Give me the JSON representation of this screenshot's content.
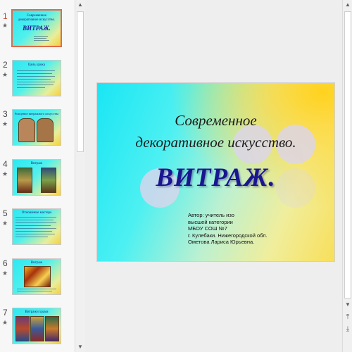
{
  "thumbnails": [
    {
      "number": "1",
      "title_lines": [
        "Современное",
        "декоративное искусство.",
        "ВИТРАЖ."
      ]
    },
    {
      "number": "2",
      "title_lines": [
        "Цель урока"
      ]
    },
    {
      "number": "3",
      "title_lines": [
        "Рождение витражного искусства"
      ]
    },
    {
      "number": "4",
      "title_lines": [
        "Витраж"
      ]
    },
    {
      "number": "5",
      "title_lines": [
        "Отношение мастера"
      ]
    },
    {
      "number": "6",
      "title_lines": [
        "Витраж"
      ]
    },
    {
      "number": "7",
      "title_lines": [
        "Витражи храма"
      ]
    }
  ],
  "star_icon": "★",
  "colors": {
    "accent": "#c9462c",
    "headline": "#1a1690",
    "slide_gradient_start": "#19e6f4",
    "slide_gradient_end": "#ffd21e"
  },
  "icons": {
    "scroll_up": "▲",
    "scroll_down": "▼",
    "prev_slide": "⤒",
    "next_slide": "⤓"
  },
  "slide": {
    "title_line1": "Современное",
    "title_line2": "декоративное искусство.",
    "headline": "ВИТРАЖ.",
    "author_lines": [
      "Автор: учитель изо",
      "высшей категории",
      "МБОУ СОШ №7",
      "г. Кулебаки. Нижегородской обл.",
      "Ометова Лариса Юрьевна."
    ]
  }
}
